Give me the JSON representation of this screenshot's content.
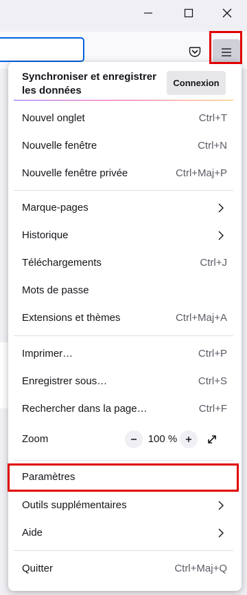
{
  "window_controls": {
    "minimize": "minimize-icon",
    "maximize": "maximize-icon",
    "close": "close-icon"
  },
  "toolbar": {
    "pocket_icon": "pocket-icon",
    "menu_icon": "hamburger-menu-icon"
  },
  "sync": {
    "title": "Synchroniser et enregistrer les données",
    "button_label": "Connexion"
  },
  "menu": {
    "new_tab": {
      "label": "Nouvel onglet",
      "shortcut": "Ctrl+T"
    },
    "new_window": {
      "label": "Nouvelle fenêtre",
      "shortcut": "Ctrl+N"
    },
    "new_private_window": {
      "label": "Nouvelle fenêtre privée",
      "shortcut": "Ctrl+Maj+P"
    },
    "bookmarks": {
      "label": "Marque-pages"
    },
    "history": {
      "label": "Historique"
    },
    "downloads": {
      "label": "Téléchargements",
      "shortcut": "Ctrl+J"
    },
    "passwords": {
      "label": "Mots de passe"
    },
    "addons": {
      "label": "Extensions et thèmes",
      "shortcut": "Ctrl+Maj+A"
    },
    "print": {
      "label": "Imprimer…",
      "shortcut": "Ctrl+P"
    },
    "save_as": {
      "label": "Enregistrer sous…",
      "shortcut": "Ctrl+S"
    },
    "find": {
      "label": "Rechercher dans la page…",
      "shortcut": "Ctrl+F"
    },
    "zoom": {
      "label": "Zoom",
      "value": "100 %",
      "out_symbol": "−",
      "in_symbol": "+"
    },
    "settings": {
      "label": "Paramètres"
    },
    "more_tools": {
      "label": "Outils supplémentaires"
    },
    "help": {
      "label": "Aide"
    },
    "quit": {
      "label": "Quitter",
      "shortcut": "Ctrl+Maj+Q"
    }
  },
  "colors": {
    "highlight": "#e00000",
    "url_focus": "#0061e0",
    "menu_button_active": "#cfcfd8"
  }
}
